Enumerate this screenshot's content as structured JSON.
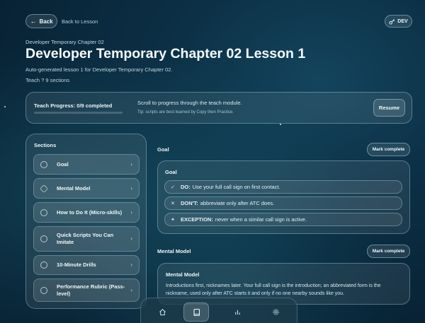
{
  "header": {
    "back_label": "Back",
    "back_link": "Back to Lesson",
    "dev_label": "DEV",
    "breadcrumb": "Developer Temporary Chapter 02",
    "title": "Developer Temporary Chapter 02 Lesson 1",
    "subtitle": "Auto-generated lesson 1 for Developer Temporary Chapter 02.",
    "meta": "Teach ? 9 sections"
  },
  "progress": {
    "label": "Teach Progress: 0/9 completed",
    "completed": 0,
    "total": 9,
    "hint": "Scroll to progress through the teach module.",
    "tip": "Tip: scripts are best learned by Copy then Practice.",
    "resume_label": "Resume"
  },
  "sections": {
    "title": "Sections",
    "items": [
      {
        "label": "Goal",
        "icon": "circle-icon"
      },
      {
        "label": "Mental Model",
        "icon": "hexagon-icon"
      },
      {
        "label": "How to Do It (Micro-skills)",
        "icon": "circle-icon"
      },
      {
        "label": "Quick Scripts You Can Imitate",
        "icon": "circle-icon"
      },
      {
        "label": "10-Minute Drills",
        "icon": "circle-icon"
      },
      {
        "label": "Performance Rubric (Pass-level)",
        "icon": "circle-icon"
      }
    ]
  },
  "goal": {
    "heading": "Goal",
    "mark_label": "Mark complete",
    "card_title": "Goal",
    "rules": [
      {
        "icon": "check-icon",
        "keyword": "DO:",
        "text": "Use your full call sign on first contact."
      },
      {
        "icon": "x-icon",
        "keyword": "DON'T:",
        "text": "abbreviate only after ATC does."
      },
      {
        "icon": "sparkle-icon",
        "keyword": "EXCEPTION:",
        "text": "never when a similar call sign is active."
      }
    ]
  },
  "mental_model": {
    "heading": "Mental Model",
    "mark_label": "Mark complete",
    "card_title": "Mental Model",
    "body": "Introductions first, nicknames later. Your full call sign is the introduction; an abbreviated form is the nickname, used only after ATC starts it and only if no one nearby sounds like you."
  },
  "bottom_nav": {
    "items": [
      "home-icon",
      "book-icon",
      "chart-icon",
      "settings-icon"
    ],
    "active": "book-icon"
  },
  "colors": {
    "background": "#0a2a3d",
    "accent": "#8fd3e0"
  }
}
